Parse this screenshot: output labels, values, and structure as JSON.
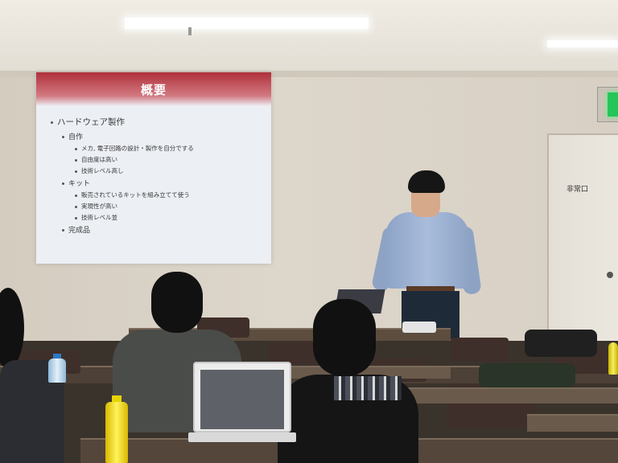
{
  "slide": {
    "title": "概要",
    "items": [
      {
        "level": 1,
        "text": "ハードウェア製作"
      },
      {
        "level": 2,
        "text": "自作"
      },
      {
        "level": 3,
        "text": "メカ, 電子回路の設計・製作を自分でする"
      },
      {
        "level": 3,
        "text": "自由度は高い"
      },
      {
        "level": 3,
        "text": "技術レベル高し"
      },
      {
        "level": 2,
        "text": "キット"
      },
      {
        "level": 3,
        "text": "販売されているキットを組み立てて使う"
      },
      {
        "level": 3,
        "text": "実現性が高い"
      },
      {
        "level": 3,
        "text": "技術レベル並"
      },
      {
        "level": 2,
        "text": "完成品"
      }
    ]
  },
  "door": {
    "sign": "非常口"
  },
  "colors": {
    "slide_header": "#b0303a",
    "exit_light": "#25c55a",
    "presenter_shirt": "#9fb2d3"
  }
}
